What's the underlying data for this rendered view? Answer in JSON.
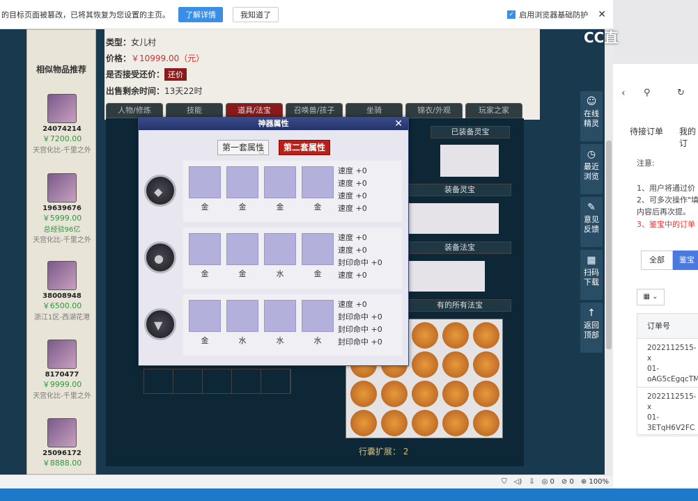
{
  "notification": {
    "message": "的目标页面被篡改，已将其恢复为您设置的主页。",
    "learn_more": "了解详情",
    "got_it": "我知道了",
    "checkbox_label": "启用浏览器基础防护",
    "checked_mark": "✓",
    "close": "✕"
  },
  "product": {
    "type_label": "类型：",
    "type_value": "女儿村",
    "price_label": "价格：",
    "price_value": "￥10999.00（元）",
    "bargain_label": "是否接受还价：",
    "bargain_value": "还价",
    "time_label": "出售剩余时间：",
    "time_value": "13天22时"
  },
  "sidebar": {
    "header": "相似物品推荐",
    "items": [
      {
        "id": "24074214",
        "price": "￥7200.00",
        "note": "天宫化比-千里之外"
      },
      {
        "id": "19639676",
        "price": "￥5999.00",
        "note2": "总经验96亿",
        "note": "天宫化比-千里之外"
      },
      {
        "id": "38008948",
        "price": "￥6500.00",
        "note": "浙江1区-西湖花港"
      },
      {
        "id": "8170477",
        "price": "￥9999.00",
        "note": "天宫化比-千里之外"
      },
      {
        "id": "25096172",
        "price": "￥8888.00",
        "note": ""
      }
    ]
  },
  "tabs": [
    "人物/修炼",
    "技能",
    "道具/法宝",
    "召唤兽/孩子",
    "坐骑",
    "锦衣/外观",
    "玩家之家"
  ],
  "labels": {
    "equipped_lingbao": "已装备灵宝",
    "lingbao2": "装备灵宝",
    "fabao": "装备法宝",
    "all_fabao": "有的所有法宝",
    "expand_label": "行囊扩展：",
    "expand_value": "2"
  },
  "modal": {
    "title": "神器属性",
    "close": "✕",
    "set1": "第一套属性",
    "set2": "第二套属性",
    "rows": [
      {
        "gems": [
          "金",
          "金",
          "金",
          "金"
        ],
        "stats": [
          "速度 +0",
          "速度 +0",
          "速度 +0",
          "速度 +0"
        ]
      },
      {
        "gems": [
          "金",
          "金",
          "水",
          "金"
        ],
        "stats": [
          "速度 +0",
          "速度 +0",
          "封印命中 +0",
          "速度 +0"
        ]
      },
      {
        "gems": [
          "金",
          "水",
          "水",
          "水"
        ],
        "stats": [
          "速度 +0",
          "封印命中 +0",
          "封印命中 +0",
          "封印命中 +0"
        ]
      }
    ]
  },
  "sidetools": [
    {
      "icon": "☺",
      "label": "在线精灵"
    },
    {
      "icon": "◷",
      "label": "最近浏览"
    },
    {
      "icon": "✎",
      "label": "意见反馈"
    },
    {
      "icon": "▦",
      "label": "扫码下载"
    },
    {
      "icon": "↑",
      "label": "返回顶部"
    }
  ],
  "right_panel": {
    "brand": "CC直",
    "tab1": "待接订单",
    "tab2": "我的订",
    "note_title": "注意:",
    "note1": "1、用户将通过价",
    "note2": "2、可多次操作\"填",
    "note3": "内容后再次提。",
    "note4": "3、鉴宝中的订单",
    "filter_all": "全部",
    "filter_jb": "鉴宝",
    "col_order": "订单号",
    "orders": [
      [
        "2022112515-x",
        "01-",
        "oAG5cEgqcTM"
      ],
      [
        "2022112515-x",
        "01-",
        "3ETqH6V2FC"
      ]
    ]
  },
  "status": {
    "zoom": "100%",
    "count1": "0",
    "count2": "0"
  }
}
